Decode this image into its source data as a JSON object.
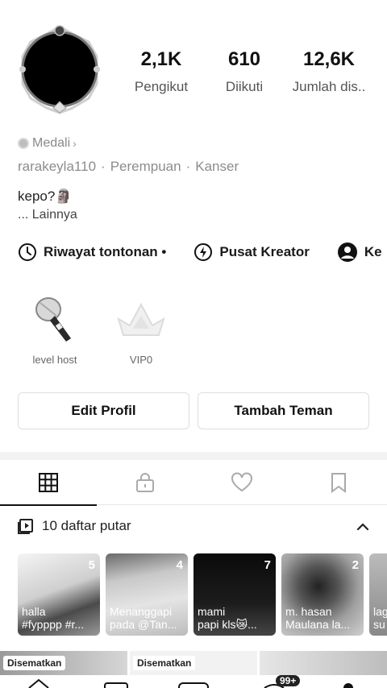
{
  "profile": {
    "stats": [
      {
        "value": "2,1K",
        "label": "Pengikut"
      },
      {
        "value": "610",
        "label": "Diikuti"
      },
      {
        "value": "12,6K",
        "label": "Jumlah dis.."
      }
    ],
    "medal_label": "Medali",
    "username": "rarakeyla110",
    "gender": "Perempuan",
    "zodiac": "Kanser",
    "bio": "kepo?🗿",
    "more_label": "... Lainnya"
  },
  "shortcuts": [
    {
      "label": "Riwayat tontonan •",
      "icon": "clock-icon"
    },
    {
      "label": "Pusat Kreator",
      "icon": "bolt-icon"
    },
    {
      "label": "Ke",
      "icon": "avatar-icon"
    }
  ],
  "badges": [
    {
      "label": "level host",
      "icon": "microphone-icon"
    },
    {
      "label": "VIP0",
      "icon": "crown-icon"
    }
  ],
  "buttons": {
    "edit": "Edit Profil",
    "add_friend": "Tambah Teman"
  },
  "tabs": [
    "grid-icon",
    "lock-icon",
    "heart-icon",
    "bookmark-icon"
  ],
  "playlist": {
    "heading": "10 daftar putar",
    "items": [
      {
        "count": "5",
        "title": "halla\n#fypppp #r..."
      },
      {
        "count": "4",
        "title": "Menanggapi\npada @Tan..."
      },
      {
        "count": "7",
        "title": "mami\npapi kls😿..."
      },
      {
        "count": "2",
        "title": "m. hasan\nMaulana la..."
      },
      {
        "count": "",
        "title": "lag\nsu"
      }
    ]
  },
  "pinned": [
    "Disematkan",
    "Disematkan"
  ],
  "nav_badge": "99+"
}
